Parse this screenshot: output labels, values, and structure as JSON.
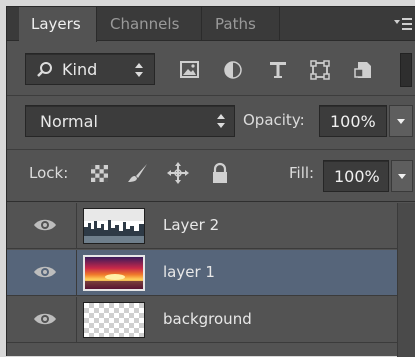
{
  "tabs": [
    {
      "label": "Layers",
      "active": true
    },
    {
      "label": "Channels",
      "active": false
    },
    {
      "label": "Paths",
      "active": false
    }
  ],
  "filter": {
    "kind_label": "Kind",
    "icons": [
      "pixel-layer-filter-icon",
      "adjustment-layer-filter-icon",
      "type-layer-filter-icon",
      "shape-layer-filter-icon",
      "smart-object-filter-icon"
    ]
  },
  "blend": {
    "mode": "Normal",
    "opacity_label": "Opacity:",
    "opacity_value": "100%"
  },
  "lock": {
    "label": "Lock:",
    "icons": [
      "lock-transparent-pixels-icon",
      "lock-image-pixels-icon",
      "lock-position-icon",
      "lock-all-icon"
    ],
    "fill_label": "Fill:",
    "fill_value": "100%"
  },
  "layers": [
    {
      "name": "Layer 2",
      "selected": false,
      "thumbnail": "city-skyline"
    },
    {
      "name": "layer 1",
      "selected": true,
      "thumbnail": "sunset"
    },
    {
      "name": "background",
      "selected": false,
      "thumbnail": "transparent"
    }
  ],
  "colors": {
    "panel_bg": "#535353",
    "tab_bar": "#3a3a3a",
    "field_bg": "#3c3c3c",
    "selected_row": "#56657a",
    "text": "#e6e6e6"
  }
}
